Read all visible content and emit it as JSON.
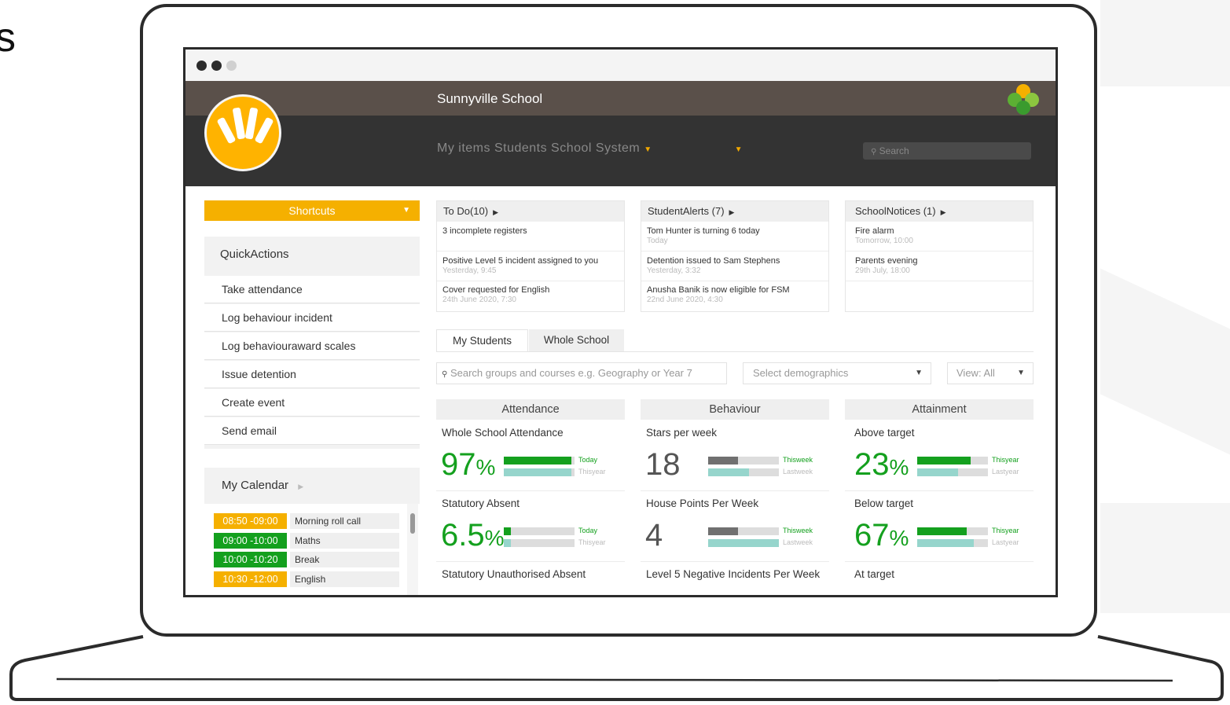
{
  "colors": {
    "accent_yellow": "#f5b000",
    "green": "#14a01e",
    "teal": "#96d5cc",
    "grey_bar": "#707070",
    "header_top": "#5a504a",
    "header_bottom": "#333333"
  },
  "window": {
    "dots": [
      "#2b2b2b",
      "#2b2b2b",
      "#d0d0d0"
    ]
  },
  "header": {
    "school_name": "Sunnyville School",
    "nav_text": "My items Students School System",
    "search_placeholder": "Search",
    "icons": {
      "search": "search-icon",
      "logo": "sun-logo-icon",
      "app": "petals-icon"
    }
  },
  "left": {
    "shortcuts_label": "Shortcuts",
    "quick_actions_title": "QuickActions",
    "quick_actions": [
      "Take attendance",
      "Log behaviour incident",
      "Log behaviouraward scales",
      "Issue detention",
      "Create event",
      "Send email"
    ],
    "calendar_title": "My Calendar",
    "calendar": [
      {
        "time": "08:50 -09:00",
        "name": "Morning roll call",
        "color": "#f5b000"
      },
      {
        "time": "09:00 -10:00",
        "name": "Maths",
        "color": "#14a01e"
      },
      {
        "time": "10:00 -10:20",
        "name": "Break",
        "color": "#14a01e"
      },
      {
        "time": "10:30 -12:00",
        "name": "English",
        "color": "#f5b000"
      }
    ]
  },
  "panels": [
    {
      "title": "To Do(10)",
      "items": [
        {
          "text": "3 incomplete registers",
          "sub": ""
        },
        {
          "text": "Positive Level 5 incident assigned to you",
          "sub": "Yesterday, 9:45"
        },
        {
          "text": "Cover requested for English",
          "sub": "24th June 2020, 7:30"
        }
      ]
    },
    {
      "title": "StudentAlerts (7)",
      "items": [
        {
          "text": "Tom Hunter is turning 6 today",
          "sub": "Today"
        },
        {
          "text": "Detention issued to Sam Stephens",
          "sub": "Yesterday, 3:32"
        },
        {
          "text": "Anusha Banik is now eligible for FSM",
          "sub": "22nd June 2020, 4:30"
        }
      ]
    },
    {
      "title": "SchoolNotices (1)",
      "items": [
        {
          "text": "Fire alarm",
          "sub": "Tomorrow, 10:00"
        },
        {
          "text": "Parents evening",
          "sub": "29th July, 18:00"
        }
      ]
    }
  ],
  "tabs": [
    "My Students",
    "Whole School"
  ],
  "filters": {
    "search_placeholder": "Search groups and courses e.g. Geography or Year 7",
    "demographics": "Select demographics",
    "view": "View: All"
  },
  "cards": [
    {
      "title": "Attendance",
      "stats": [
        {
          "label": "Whole School Attendance",
          "value": "97",
          "unit": "%",
          "value_color": "#14a01e",
          "bars": [
            {
              "label": "Today",
              "fill": 0.95,
              "color": "#14a01e",
              "label_color": "#14a01e"
            },
            {
              "label": "Thisyear",
              "fill": 0.95,
              "color": "#96d5cc",
              "label_color": "#bbbbbb"
            }
          ]
        },
        {
          "label": "Statutory Absent",
          "value": "6.5",
          "unit": "%",
          "value_color": "#14a01e",
          "bars": [
            {
              "label": "Today",
              "fill": 0.1,
              "color": "#14a01e",
              "label_color": "#14a01e"
            },
            {
              "label": "Thisyear",
              "fill": 0.1,
              "color": "#96d5cc",
              "label_color": "#bbbbbb"
            }
          ]
        },
        {
          "label": "Statutory Unauthorised Absent"
        }
      ]
    },
    {
      "title": "Behaviour",
      "stats": [
        {
          "label": "Stars per week",
          "value": "18",
          "unit": "",
          "value_color": "#555555",
          "bars": [
            {
              "label": "Thisweek",
              "fill": 0.42,
              "color": "#707070",
              "label_color": "#14a01e"
            },
            {
              "label": "Lastweek",
              "fill": 0.58,
              "color": "#96d5cc",
              "label_color": "#bbbbbb"
            }
          ]
        },
        {
          "label": "House Points Per Week",
          "value": "4",
          "unit": "",
          "value_color": "#555555",
          "bars": [
            {
              "label": "Thisweek",
              "fill": 0.42,
              "color": "#707070",
              "label_color": "#14a01e"
            },
            {
              "label": "Lastweek",
              "fill": 1.0,
              "color": "#96d5cc",
              "label_color": "#bbbbbb"
            }
          ]
        },
        {
          "label": "Level 5 Negative Incidents Per Week"
        }
      ]
    },
    {
      "title": "Attainment",
      "stats": [
        {
          "label": "Above target",
          "value": "23",
          "unit": "%",
          "value_color": "#14a01e",
          "bars": [
            {
              "label": "Thisyear",
              "fill": 0.76,
              "color": "#14a01e",
              "label_color": "#14a01e"
            },
            {
              "label": "Lastyear",
              "fill": 0.58,
              "color": "#96d5cc",
              "label_color": "#bbbbbb"
            }
          ]
        },
        {
          "label": "Below target",
          "value": "67",
          "unit": "%",
          "value_color": "#14a01e",
          "bars": [
            {
              "label": "Thisyear",
              "fill": 0.7,
              "color": "#14a01e",
              "label_color": "#14a01e"
            },
            {
              "label": "Lastyear",
              "fill": 0.8,
              "color": "#96d5cc",
              "label_color": "#bbbbbb"
            }
          ]
        },
        {
          "label": "At target"
        }
      ]
    }
  ]
}
